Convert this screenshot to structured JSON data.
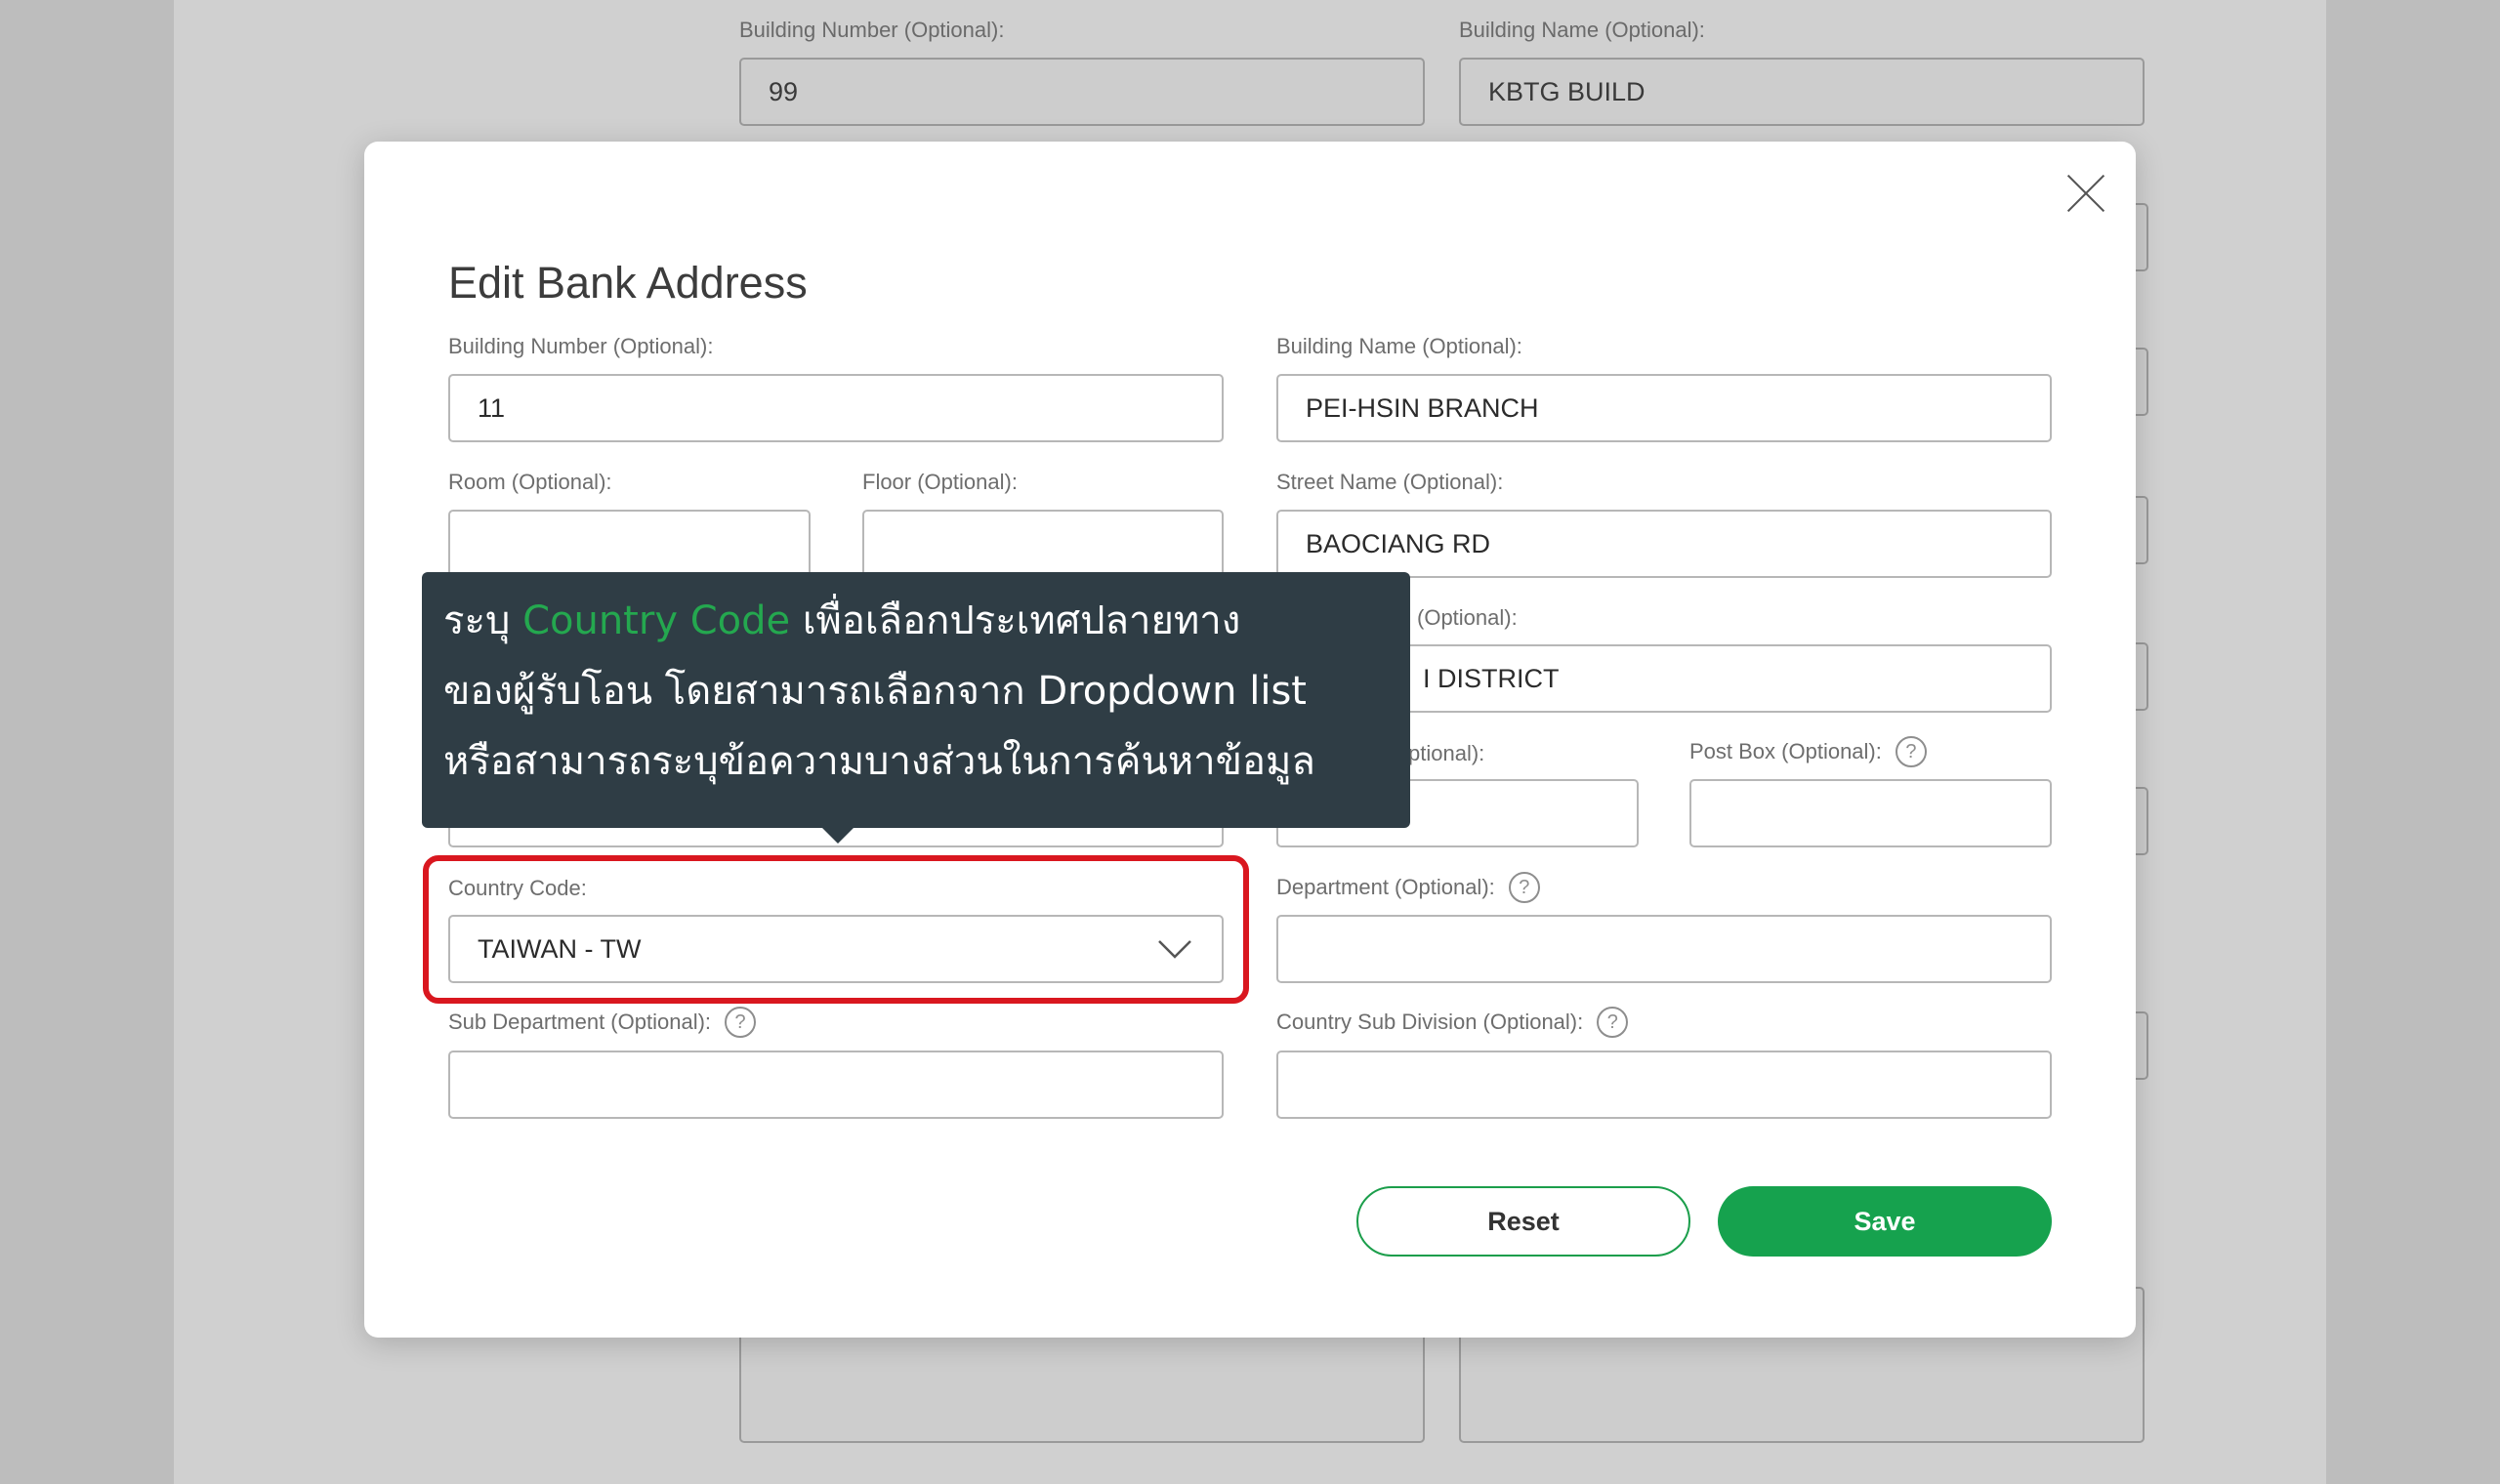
{
  "background": {
    "fields": [
      {
        "label": "Building Number (Optional):",
        "value": "99"
      },
      {
        "label": "Building Name (Optional):",
        "value": "KBTG BUILD"
      }
    ]
  },
  "modal": {
    "title": "Edit Bank Address",
    "fields": {
      "building_number": {
        "label": "Building Number (Optional):",
        "value": "11"
      },
      "building_name": {
        "label": "Building Name (Optional):",
        "value": "PEI-HSIN BRANCH"
      },
      "room": {
        "label": "Room (Optional):",
        "value": ""
      },
      "floor": {
        "label": "Floor (Optional):",
        "value": ""
      },
      "street_name": {
        "label": "Street Name (Optional):",
        "value": "BAOCIANG RD"
      },
      "district_label_fragment": "(Optional):",
      "district_value_fragment": "I DISTRICT",
      "postcode_label_fragment": "ptional):",
      "post_box": {
        "label": "Post Box (Optional):",
        "value": ""
      },
      "country_code": {
        "label": "Country Code:",
        "value": "TAIWAN - TW"
      },
      "department": {
        "label": "Department (Optional):",
        "value": ""
      },
      "sub_department": {
        "label": "Sub Department (Optional):",
        "value": ""
      },
      "country_sub_division": {
        "label": "Country Sub Division (Optional):",
        "value": ""
      }
    },
    "help_symbol": "?",
    "buttons": {
      "reset": "Reset",
      "save": "Save"
    }
  },
  "tooltip": {
    "line1_before": "ระบุ ",
    "line1_highlight": "Country Code",
    "line1_after": " เพื่อเลือกประเทศปลายทาง",
    "line2": "ของผู้รับโอน โดยสามารถเลือกจาก Dropdown list",
    "line3": "หรือสามารถระบุข้อความบางส่วนในการค้นหาข้อมูล"
  },
  "colors": {
    "accent_green": "#16a24e",
    "highlight_red": "#d9171f",
    "tooltip_bg": "#2f3d45"
  },
  "icons": {
    "close": "close-icon",
    "chevron": "chevron-down-icon",
    "help": "help-circle-icon"
  }
}
